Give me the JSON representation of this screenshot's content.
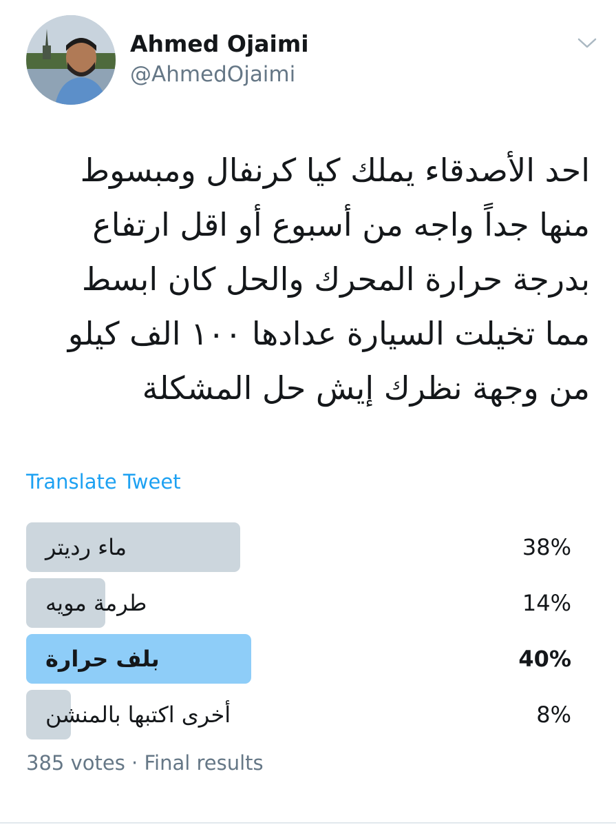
{
  "user": {
    "name": "Ahmed Ojaimi",
    "handle": "@AhmedOjaimi",
    "avatar_icon": "profile-photo"
  },
  "tweet": {
    "lines": [
      "احد الأصدقاء يملك كيا كرنفال ومبسوط",
      "منها جداً واجه من أسبوع أو اقل ارتفاع",
      "بدرجة حرارة المحرك والحل كان ابسط",
      "مما تخيلت السيارة عدادها ١٠٠ الف كيلو",
      "من وجهة نظرك إيش حل المشكلة"
    ]
  },
  "translate_label": "Translate Tweet",
  "poll": {
    "options": [
      {
        "label": "ماء رديتر",
        "percent_text": "38%",
        "percent": 38,
        "winner": false
      },
      {
        "label": "طرمة مويه",
        "percent_text": "14%",
        "percent": 14,
        "winner": false
      },
      {
        "label": "بلف حرارة",
        "percent_text": "40%",
        "percent": 40,
        "winner": true
      },
      {
        "label": "أخرى اكتبها بالمنشن",
        "percent_text": "8%",
        "percent": 8,
        "winner": false
      }
    ],
    "footer": "385 votes · Final results"
  },
  "colors": {
    "accent": "#1da1f2",
    "bar": "#ccd6dd",
    "winner_bar": "#8ecdf8",
    "secondary_text": "#657786"
  }
}
